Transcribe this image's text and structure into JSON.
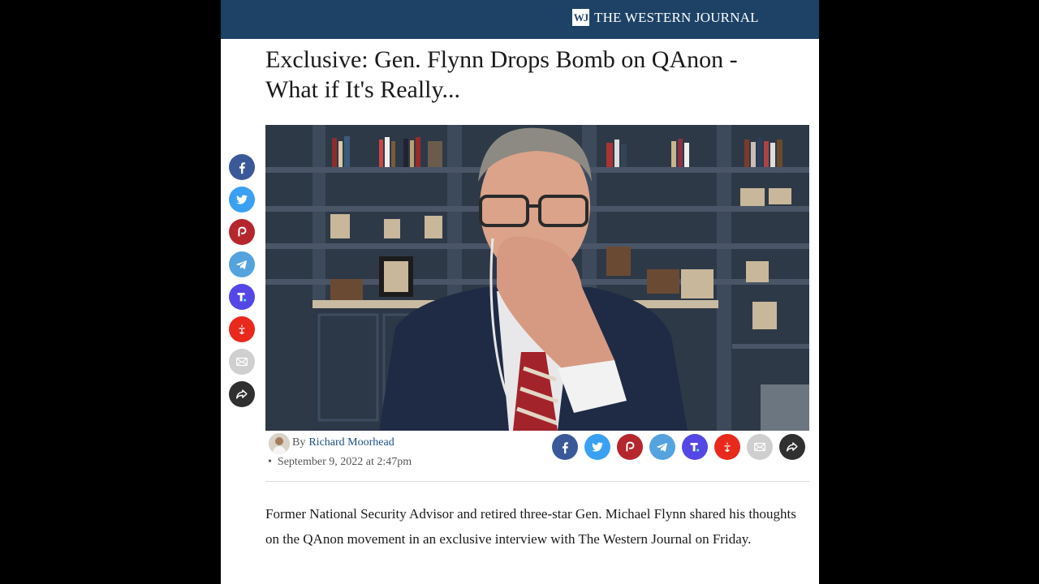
{
  "site": {
    "logo_text": "WJ",
    "name": "THE WESTERN JOURNAL"
  },
  "article": {
    "title": "Exclusive: Gen. Flynn Drops Bomb on QAnon - What if It's Really...",
    "byline_prefix": "By",
    "author": "Richard Moorhead",
    "date_bullet": "•",
    "date": "September 9, 2022 at 2:47pm",
    "lead": "Former National Security Advisor and retired three-star Gen. Michael Flynn shared his thoughts on the QAnon movement in an exclusive interview with The Western Journal on Friday."
  },
  "share_buttons": [
    {
      "name": "facebook",
      "icon": "facebook-icon",
      "color": "#3b5998"
    },
    {
      "name": "twitter",
      "icon": "twitter-icon",
      "color": "#3aa1f2"
    },
    {
      "name": "parler",
      "icon": "parler-icon",
      "color": "#b5272d"
    },
    {
      "name": "telegram",
      "icon": "telegram-icon",
      "color": "#54a3de"
    },
    {
      "name": "truth-social",
      "icon": "truth-social-icon",
      "color": "#5447e6"
    },
    {
      "name": "gettr",
      "icon": "gettr-icon",
      "color": "#e8291c"
    },
    {
      "name": "email",
      "icon": "email-icon",
      "color": "#cfcfcf"
    },
    {
      "name": "share",
      "icon": "share-arrow-icon",
      "color": "#303030"
    }
  ],
  "colors": {
    "topbar": "#1d4266",
    "author_link": "#1d4e85"
  }
}
